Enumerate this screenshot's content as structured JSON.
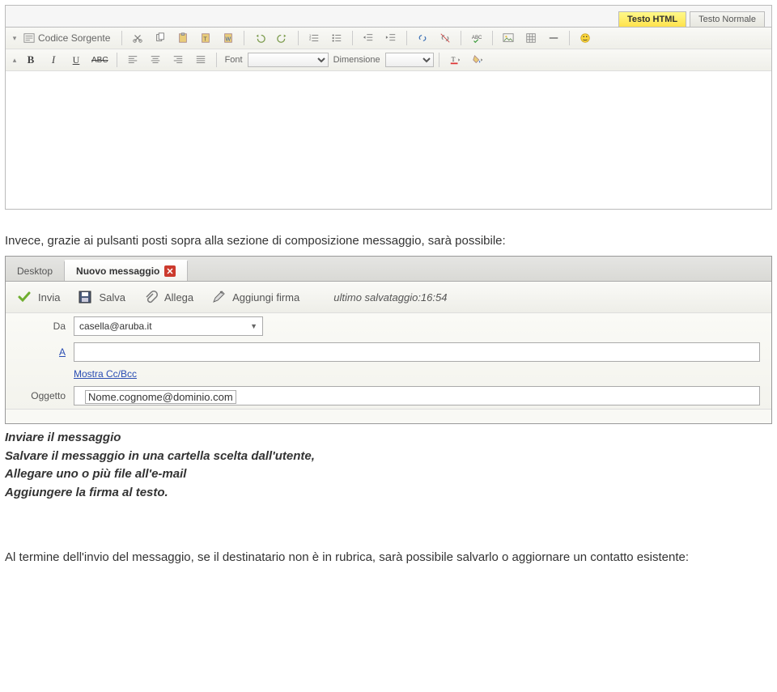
{
  "tabs": {
    "html": "Testo HTML",
    "plain": "Testo Normale"
  },
  "toolbar1": {
    "source_label": "Codice Sorgente"
  },
  "toolbar2": {
    "font_label": "Font",
    "size_label": "Dimensione"
  },
  "para_intro": "Invece, grazie ai pulsanti posti sopra alla sezione di composizione messaggio, sarà possibile:",
  "compose": {
    "tab_desktop": "Desktop",
    "tab_new": "Nuovo messaggio",
    "actions": {
      "send": "Invia",
      "save": "Salva",
      "attach": "Allega",
      "add_sign": "Aggiungi firma"
    },
    "status_label": "ultimo salvataggio:16:54",
    "fields": {
      "from_label": "Da",
      "from_value": "casella@aruba.it",
      "a_label": "A",
      "ccbcc_label": "Mostra Cc/Bcc",
      "subject_label": "Oggetto",
      "overlay_value": "Nome.cognome@dominio.com"
    }
  },
  "bullets": {
    "b1": "Inviare il messaggio",
    "b2": "Salvare il messaggio in una cartella scelta dall'utente,",
    "b3": "Allegare uno o più file all'e-mail",
    "b4": "Aggiungere la firma al testo."
  },
  "para_outro": "Al termine dell'invio del messaggio, se il destinatario non è in rubrica, sarà possibile salvarlo o aggiornare un contatto esistente:"
}
